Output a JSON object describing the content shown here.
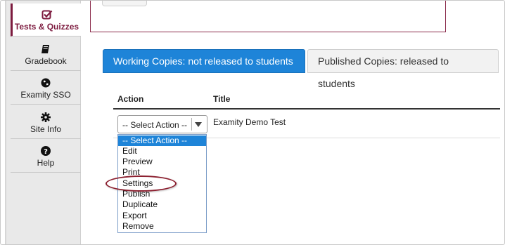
{
  "sidebar": {
    "items": [
      {
        "label": "Tests & Quizzes",
        "icon": "check-square-icon",
        "active": true
      },
      {
        "label": "Gradebook",
        "icon": "book-icon",
        "active": false
      },
      {
        "label": "Examity SSO",
        "icon": "globe-icon",
        "active": false
      },
      {
        "label": "Site Info",
        "icon": "gear-icon",
        "active": false
      },
      {
        "label": "Help",
        "icon": "question-circle-icon",
        "active": false
      }
    ],
    "accent_color": "#7d1b3f"
  },
  "tabs": {
    "working": {
      "bold": "Working Copies:",
      "rest": " not released to students"
    },
    "published": {
      "bold": "Published Copies:",
      "rest": " released to students"
    },
    "active_color": "#1e84d8"
  },
  "table": {
    "headers": {
      "action": "Action",
      "title": "Title"
    },
    "rows": [
      {
        "title": "Examity Demo Test"
      }
    ]
  },
  "select": {
    "value": "-- Select Action --",
    "options": [
      "-- Select Action --",
      "Edit",
      "Preview",
      "Print",
      "Settings",
      "Publish",
      "Duplicate",
      "Export",
      "Remove"
    ],
    "highlighted_option": "Settings"
  }
}
